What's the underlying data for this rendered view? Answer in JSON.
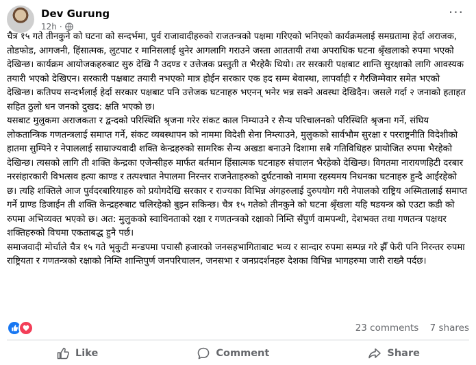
{
  "post": {
    "author": "Dev Gurung",
    "time": "12h",
    "dot": "·",
    "more": "···",
    "paragraphs": [
      "चैत्र १५ गते तीनकुने को घटना को सन्दर्भमा, पुर्व राजावादीहरुको  राजतन्त्रको पक्षमा गरिएको भनिएको कार्यक्रमलाई समग्रतामा हेर्दा अराजक, तोडफोड, आगजनी, हिंसात्मक, लुटपाट र मानिसलाई थुनेर आगलागि गराउने जस्ता आततायी तथा अपराधिक घटना श्रृँखलाको रुपमा भएको देखिन्छ।                  कार्यक्रम आयोजकहरुबाट सुरु देखि नै उदण्ड र उत्तेजक प्रस्तुती त भैरहेकै थियो। तर सरकारी पक्षबाट शान्ति सुरक्षाको लागि आवस्यक तयारी भएको देखिएन। सरकारी पक्षबाट तयारी नभएको मात्र होईन सरकार एक हद सम्म बेवास्था, लापर्वाही र गैरजिम्मेवार समेत भएको देखिन्छ। कतिपय सन्दर्भलाई हेर्दा सरकार पक्षबाट पनि उत्तेजक घटनाहरु भएनन् भनेर भन्न सक्ने अवस्था देखिदैन। जसले गर्दा २ जनाको हताहत सहित ठुलो धन जनको दुखद: क्षति भएको छ।",
      "यसबाट मुलुकमा अराजकता र द्वन्दको परिस्थिति श्रृजना गरेर संकट काल निम्याउने र सैन्य परिचालनको परिस्थिति श्रृजना गर्ने, संघिय लोकतान्त्रिक गणतन्त्रलाई समाप्त गर्ने, संकट व्यबस्थापन को नाममा विदेशी सेना निम्त्याउने, मुलुकको सार्वभौम सुरक्षा र परराष्ट्रनीति विदेशीको हातमा सुम्पिने र नेपाललाई साम्राज्यवादी शक्ति केन्द्रहरुको सामरिक सैन्य अखडा बनाउने दिशामा सबै गतिविधिहरु प्रायोजित रुपमा भैरहेको देखिन्छ। त्यसको लागि ती शक्ति केन्द्रका एजेन्सीहरु मार्फत बर्तमान हिंसात्मक घटनाहरु संचालन भैरहेको देखिन्छ। विगतमा नारायणहिटी दरबार नरसंहारकारी विभत्सव हत्या काण्ड र तत्पश्चात नेपालमा निरन्तर राजनेताहरुको दुर्घटनाको नाममा रहस्यमय निधनका घटनाहरु हुन्दै आईरहेको छ। त्यहि शक्तिले आज पुर्वदरबारियाहरु को प्रयोगदेखि सरकार र राज्यका विभिन्न अंगहरुलाई दुरुपयोग गरी नेपालको राष्ट्रिय अस्मितालाई समाप्त गर्ने ग्राण्ड डिजाईन ती शक्ति केन्द्रहरुबाट चलिरहेको बुझ्न सकिन्छ। चैत्र १५ गतेको तीनकुने को घटना श्रृँखला यहि षडयन्त्र को एउटा कडी को रुपमा अभिव्यक्त भएको छ। अत: मुलुकको स्वाधिनताको रक्षा र गणतन्त्रको रक्षाको निम्ति सँपुर्ण वामपन्थी, देशभक्त तथा गणतन्त्र पक्षधर शक्तिहरुको विचमा एकताबद्ध हुनै पर्छ।",
      "समाजवादी मोर्चाले चैत्र १५ गते भृकुटी मन्डपमा पचासौ हजारको जनसहभागिताबाट भव्य र सान्दार रुपमा सम्पन्न गरे झैँ फेरी पनि निरन्तर रुपमा राष्ट्रियता र गणतन्त्रको रक्षाको निम्ति शान्तिपुर्ण जनपरिचालन, जनसभा र जनप्रदर्शनहरु देशका विभिन्न भागहरुमा जारी राख्नै पर्दछ।"
    ]
  },
  "stats": {
    "comments": "23 comments",
    "shares": "7 shares"
  },
  "actions": {
    "like": "Like",
    "comment": "Comment",
    "share": "Share"
  },
  "icons": [
    "globe-icon",
    "like-reaction-icon",
    "love-reaction-icon",
    "thumbs-up-icon",
    "comment-icon",
    "share-icon"
  ],
  "colors": {
    "like_blue": "#1877f2",
    "love_red": "#f33e58",
    "secondary_text": "#65676b"
  }
}
